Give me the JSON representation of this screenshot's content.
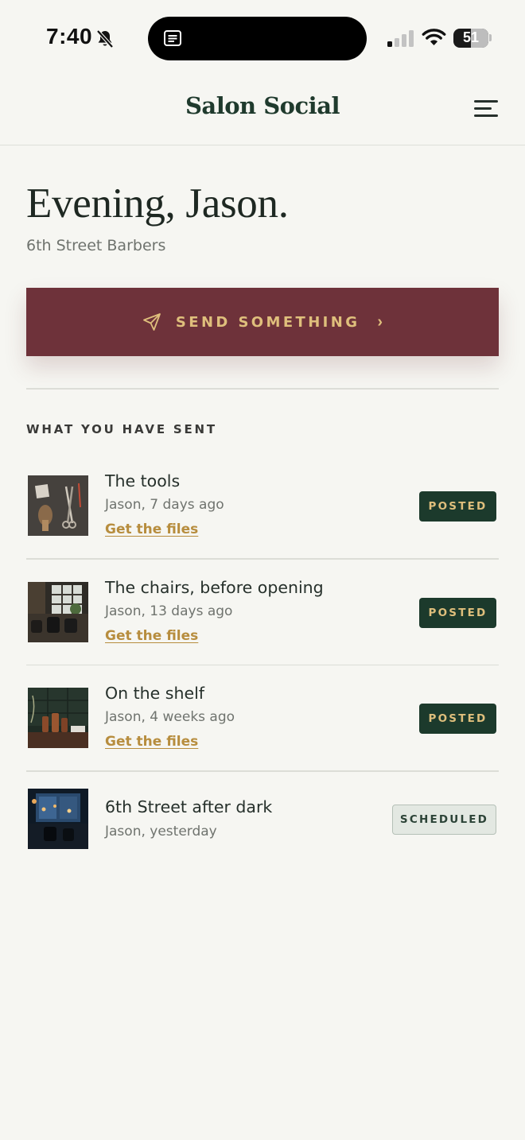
{
  "status_bar": {
    "time": "7:40",
    "battery": "51",
    "battery_level": 0.51
  },
  "header": {
    "brand": "Salon Social"
  },
  "greeting": {
    "headline": "Evening, Jason.",
    "shop": "6th Street Barbers"
  },
  "send_button": {
    "label": "SEND SOMETHING",
    "chevron": "›"
  },
  "section": {
    "title": "WHAT YOU HAVE SENT"
  },
  "posts": [
    {
      "title": "The tools",
      "meta": "Jason, 7 days ago",
      "link": "Get the files",
      "status": "POSTED"
    },
    {
      "title": "The chairs, before opening",
      "meta": "Jason, 13 days ago",
      "link": "Get the files",
      "status": "POSTED"
    },
    {
      "title": "On the shelf",
      "meta": "Jason, 4 weeks ago",
      "link": "Get the files",
      "status": "POSTED"
    },
    {
      "title": "6th Street after dark",
      "meta": "Jason, yesterday",
      "status": "SCHEDULED"
    }
  ],
  "colors": {
    "background": "#f6f6f2",
    "brand_green": "#1f3a2d",
    "cta_maroon": "#6e323a",
    "gold": "#dfbf7c",
    "link_gold": "#b78d3e"
  },
  "icons": {
    "status_bar": [
      "bell-slash-icon",
      "notes-icon",
      "cellular-signal-icon",
      "wifi-icon",
      "battery-icon"
    ],
    "header": "hamburger-menu-icon",
    "send": "paper-plane-icon"
  }
}
